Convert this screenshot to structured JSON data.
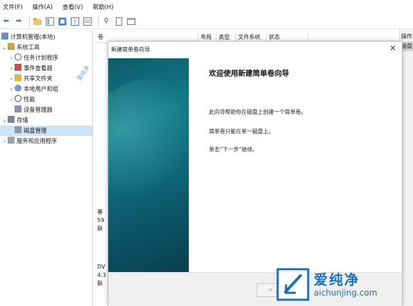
{
  "menu": [
    "文件(F)",
    "操作(A)",
    "查看(V)",
    "帮助(H)"
  ],
  "tree": {
    "root": "计算机管理(本地)",
    "system_tools": "系统工具",
    "task_scheduler": "任务计划程序",
    "event_viewer": "事件查看器",
    "shared_folders": "共享文件夹",
    "local_users": "本地用户和组",
    "performance": "性能",
    "device_manager": "设备管理器",
    "storage": "存储",
    "disk_management": "磁盘管理",
    "services": "服务和应用程序"
  },
  "columns": [
    "卷",
    "布局",
    "类型",
    "文件系统",
    "状态"
  ],
  "ops": {
    "title": "操作",
    "item": "磁盘"
  },
  "disks": {
    "d0_a": "基",
    "d0_b": "59",
    "d0_c": "联",
    "d1_a": "DV",
    "d1_b": "4.3",
    "d1_c": "联"
  },
  "dialog": {
    "title": "新建简单卷向导",
    "welcome": "欢迎使用新建简单卷向导",
    "p1": "此向导帮助你在磁盘上创建一个简单卷。",
    "p2": "简单卷只能在单一磁盘上。",
    "p3": "单击“下一步”继续。",
    "prev": "< 上",
    "close": "×"
  },
  "watermark": {
    "cn": "爱纯净",
    "en": "aichunjing.com",
    "small": "爱纯净"
  },
  "colors": {
    "banner": "#0e6778",
    "selection": "#cce4f7",
    "brand": "#1b6fb6"
  }
}
